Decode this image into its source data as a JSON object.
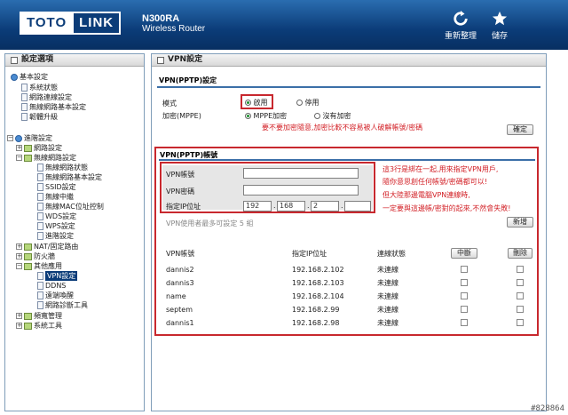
{
  "header": {
    "logo_left": "TOTO",
    "logo_right": "LINK",
    "model": "N300RA",
    "product": "Wireless Router",
    "reload_label": "重新整理",
    "save_label": "儲存"
  },
  "sidebar": {
    "title": "設定選項",
    "basic": {
      "label": "基本設定",
      "items": [
        "系統狀態",
        "網路連線設定",
        "無線網路基本設定",
        "韌體升級"
      ]
    },
    "advanced": {
      "label": "進階設定",
      "network": "網路設定",
      "wireless": "無線網路設定",
      "wireless_items": [
        "無線網路狀態",
        "無線網路基本設定",
        "SSID設定",
        "無線中繼",
        "無線MAC位址控制",
        "WDS設定",
        "WPS設定",
        "進階設定"
      ],
      "nat": "NAT/固定路由",
      "firewall": "防火牆",
      "other": "其他應用",
      "other_items": [
        "VPN設定",
        "DDNS",
        "遠端喚醒",
        "網路診斷工具"
      ],
      "bandwidth": "頻寬管理",
      "tools": "系統工具"
    }
  },
  "main": {
    "title": "VPN設定",
    "pptp_settings_heading": "VPN(PPTP)設定",
    "mode_label": "模式",
    "enable_label": "啟用",
    "disable_label": "停用",
    "encrypt_label": "加密(MPPE)",
    "mppe_label": "MPPE加密",
    "no_encrypt_label": "沒有加密",
    "encrypt_note": "要不要加密隨意,加密比較不容易被人破解帳號/密碼",
    "confirm_label": "確定",
    "account_heading": "VPN(PPTP)帳號",
    "account_label": "VPN帳號",
    "password_label": "VPN密碼",
    "ip_label": "指定IP位址",
    "ip": [
      "192",
      "168",
      "2",
      ""
    ],
    "limit_note": "VPN使用者最多可設定 5 組",
    "add_label": "新增",
    "side_note": [
      "這3行是綁在一起,用來指定VPN用戶,",
      "隨你意思創任何帳號/密碼都可以!",
      "但大陸那邊電腦VPN連線時,",
      "一定要與這邊帳/密對的起來,不然會失敗!"
    ],
    "columns": {
      "account": "VPN帳號",
      "ip": "指定IP位址",
      "status": "連線狀態",
      "disconnect": "中斷",
      "delete": "刪除"
    },
    "rows": [
      {
        "account": "dannis2",
        "ip": "192.168.2.102",
        "status": "未連線"
      },
      {
        "account": "dannis3",
        "ip": "192.168.2.103",
        "status": "未連線"
      },
      {
        "account": "name",
        "ip": "192.168.2.104",
        "status": "未連線"
      },
      {
        "account": "septem",
        "ip": "192.168.2.99",
        "status": "未連線"
      },
      {
        "account": "dannis1",
        "ip": "192.168.2.98",
        "status": "未連線"
      }
    ]
  },
  "watermark": "#828864"
}
